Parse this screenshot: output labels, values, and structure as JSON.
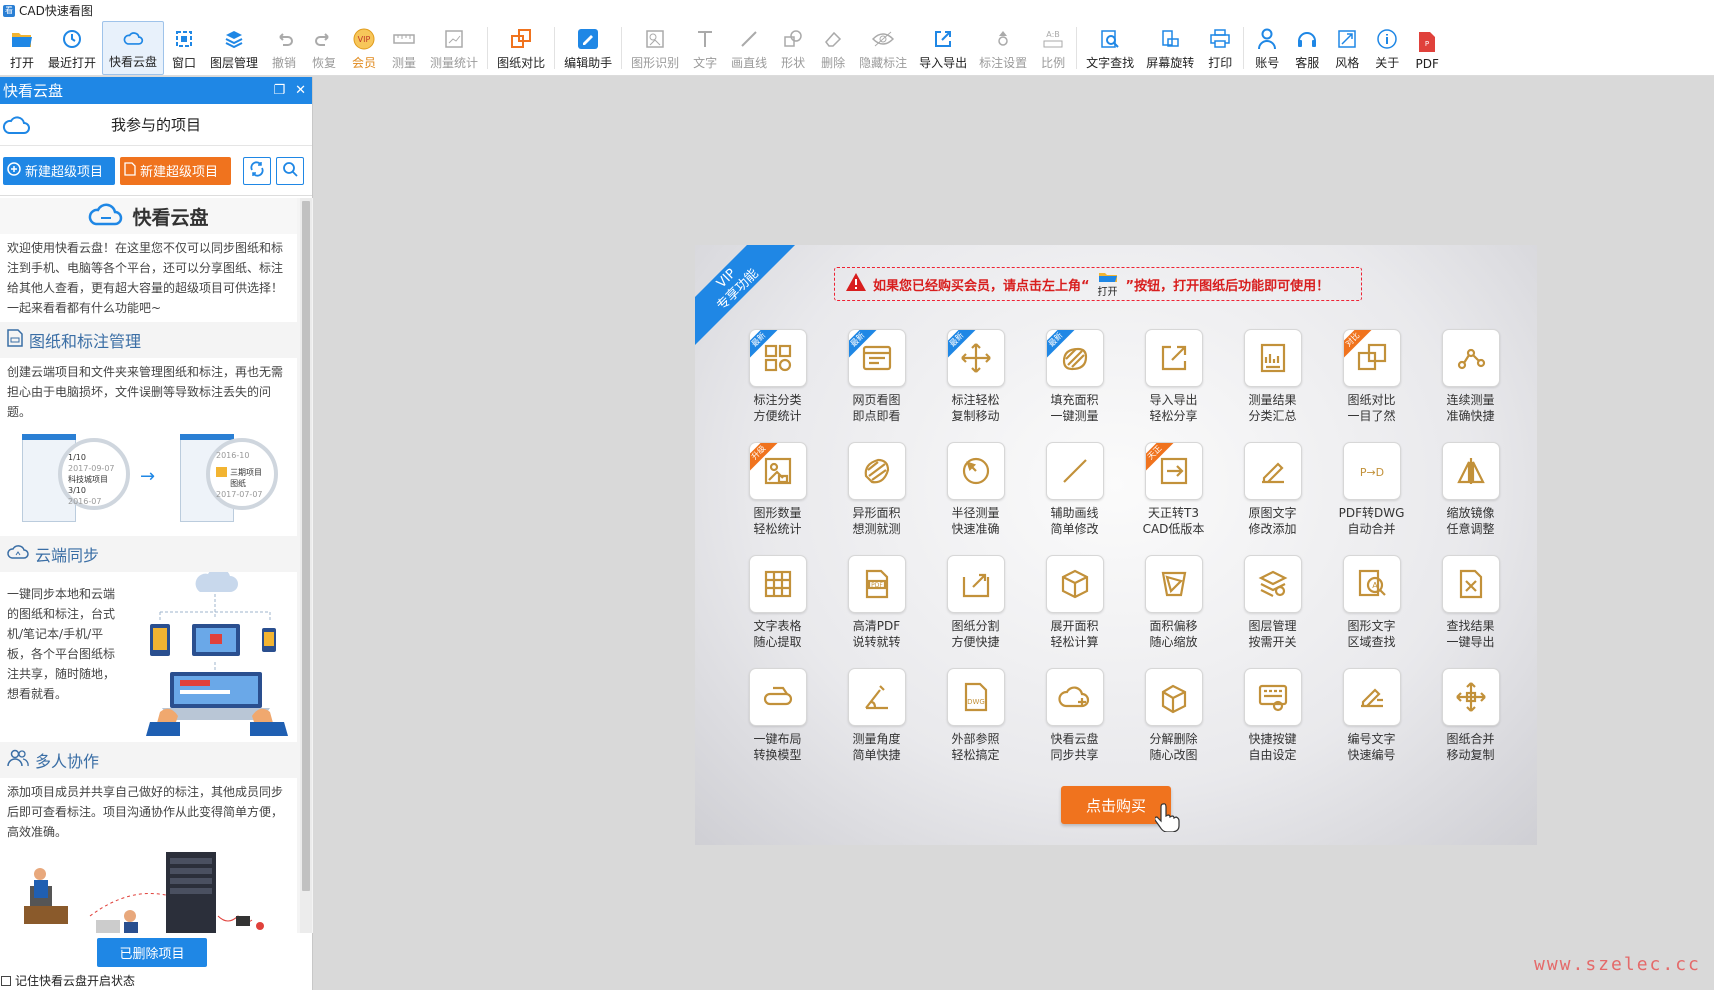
{
  "window": {
    "title": "CAD快速看图"
  },
  "toolbar": {
    "buttons": [
      {
        "label": "打开",
        "icon": "open-folder-icon"
      },
      {
        "label": "最近打开",
        "icon": "recent-icon"
      },
      {
        "label": "快看云盘",
        "icon": "cloud-icon"
      },
      {
        "label": "窗口",
        "icon": "window-icon"
      },
      {
        "label": "图层管理",
        "icon": "layers-icon"
      },
      {
        "label": "撤销",
        "icon": "undo-icon"
      },
      {
        "label": "恢复",
        "icon": "redo-icon"
      },
      {
        "label": "会员",
        "icon": "vip-icon"
      },
      {
        "label": "测量",
        "icon": "measure-icon"
      },
      {
        "label": "测量统计",
        "icon": "measure-stats-icon"
      },
      {
        "label": "图纸对比",
        "icon": "compare-icon"
      },
      {
        "label": "编辑助手",
        "icon": "edit-assistant-icon"
      },
      {
        "label": "图形识别",
        "icon": "shape-recognize-icon"
      },
      {
        "label": "文字",
        "icon": "text-icon"
      },
      {
        "label": "画直线",
        "icon": "line-icon"
      },
      {
        "label": "形状",
        "icon": "shape-icon"
      },
      {
        "label": "删除",
        "icon": "eraser-icon"
      },
      {
        "label": "隐藏标注",
        "icon": "hide-eye-icon"
      },
      {
        "label": "导入导出",
        "icon": "import-export-icon"
      },
      {
        "label": "标注设置",
        "icon": "annotation-settings-icon"
      },
      {
        "label": "比例",
        "icon": "scale-icon"
      },
      {
        "label": "文字查找",
        "icon": "text-search-icon"
      },
      {
        "label": "屏幕旋转",
        "icon": "rotate-screen-icon"
      },
      {
        "label": "打印",
        "icon": "printer-icon"
      },
      {
        "label": "账号",
        "icon": "user-icon"
      },
      {
        "label": "客服",
        "icon": "headset-icon"
      },
      {
        "label": "风格",
        "icon": "style-icon"
      },
      {
        "label": "关于",
        "icon": "info-icon"
      },
      {
        "label": "PDF",
        "icon": "pdf-icon"
      }
    ]
  },
  "panel": {
    "title": "快看云盘",
    "section_title": "我参与的项目",
    "new_project_blue": "新建超级项目",
    "new_project_orange": "新建超级项目",
    "logo_text": "快看云盘",
    "intro": "欢迎使用快看云盘！在这里您不仅可以同步图纸和标注到手机、电脑等各个平台，还可以分享图纸、标注给其他人查看，更有超大容量的超级项目可供选择！一起来看看都有什么功能吧~",
    "sections": [
      {
        "title": "图纸和标注管理",
        "text": "创建云端项目和文件夹来管理图纸和标注，再也无需担心由于电脑损坏，文件误删等导致标注丢失的问题。"
      },
      {
        "title": "云端同步",
        "text": "一键同步本地和云端的图纸和标注，台式机/笔记本/手机/平板，各个平台图纸标注共享，随时随地，想看就看。"
      },
      {
        "title": "多人协作",
        "text": "添加项目成员并共享自己做好的标注，其他成员同步后即可查看标注。项目沟通协作从此变得简单方便，高效准确。"
      }
    ],
    "illus_labels": {
      "card1_num": "1/10",
      "card1_name": "科技城项目",
      "card1_date": "2017-09-07",
      "card2_num": "3/10",
      "card2_date": "2016-07",
      "card3_name": "三期项目图纸",
      "card3_date": "2017-07-07",
      "card3_top": "2016-10"
    },
    "deleted_button": "已删除项目",
    "remember_label": "记住快看云盘开启状态"
  },
  "vip": {
    "ribbon_line1": "VIP",
    "ribbon_line2": "专享功能",
    "notice_before": "如果您已经购买会员，请点击左上角“",
    "notice_open": "打开",
    "notice_after": "”按钮，打开图纸后功能即可使用！",
    "tag_new": "最新",
    "tag_compare": "对比",
    "tag_upgrade": "升级",
    "tag_tz": "天正",
    "features": [
      {
        "l1": "标注分类",
        "l2": "方便统计"
      },
      {
        "l1": "网页看图",
        "l2": "即点即看"
      },
      {
        "l1": "标注轻松",
        "l2": "复制移动"
      },
      {
        "l1": "填充面积",
        "l2": "一键测量"
      },
      {
        "l1": "导入导出",
        "l2": "轻松分享"
      },
      {
        "l1": "测量结果",
        "l2": "分类汇总"
      },
      {
        "l1": "图纸对比",
        "l2": "一目了然"
      },
      {
        "l1": "连续测量",
        "l2": "准确快捷"
      },
      {
        "l1": "图形数量",
        "l2": "轻松统计"
      },
      {
        "l1": "异形面积",
        "l2": "想测就测"
      },
      {
        "l1": "半径测量",
        "l2": "快速准确"
      },
      {
        "l1": "辅助画线",
        "l2": "简单修改"
      },
      {
        "l1": "天正转T3",
        "l2": "CAD低版本"
      },
      {
        "l1": "原图文字",
        "l2": "修改添加"
      },
      {
        "l1": "PDF转DWG",
        "l2": "自动合并"
      },
      {
        "l1": "缩放镜像",
        "l2": "任意调整"
      },
      {
        "l1": "文字表格",
        "l2": "随心提取"
      },
      {
        "l1": "高清PDF",
        "l2": "说转就转"
      },
      {
        "l1": "图纸分割",
        "l2": "方便快捷"
      },
      {
        "l1": "展开面积",
        "l2": "轻松计算"
      },
      {
        "l1": "面积偏移",
        "l2": "随心缩放"
      },
      {
        "l1": "图层管理",
        "l2": "按需开关"
      },
      {
        "l1": "图形文字",
        "l2": "区域查找"
      },
      {
        "l1": "查找结果",
        "l2": "一键导出"
      },
      {
        "l1": "一键布局",
        "l2": "转换模型"
      },
      {
        "l1": "测量角度",
        "l2": "简单快捷"
      },
      {
        "l1": "外部参照",
        "l2": "轻松搞定"
      },
      {
        "l1": "快看云盘",
        "l2": "同步共享"
      },
      {
        "l1": "分解删除",
        "l2": "随心改图"
      },
      {
        "l1": "快捷按键",
        "l2": "自由设定"
      },
      {
        "l1": "编号文字",
        "l2": "快速编号"
      },
      {
        "l1": "图纸合并",
        "l2": "移动复制"
      }
    ],
    "buy_label": "点击购买"
  },
  "watermark": "www.szelec.cc",
  "colors": {
    "accent": "#1f87e5",
    "orange": "#f0731e",
    "gold": "#c2913a",
    "warning": "#d81e1e"
  }
}
